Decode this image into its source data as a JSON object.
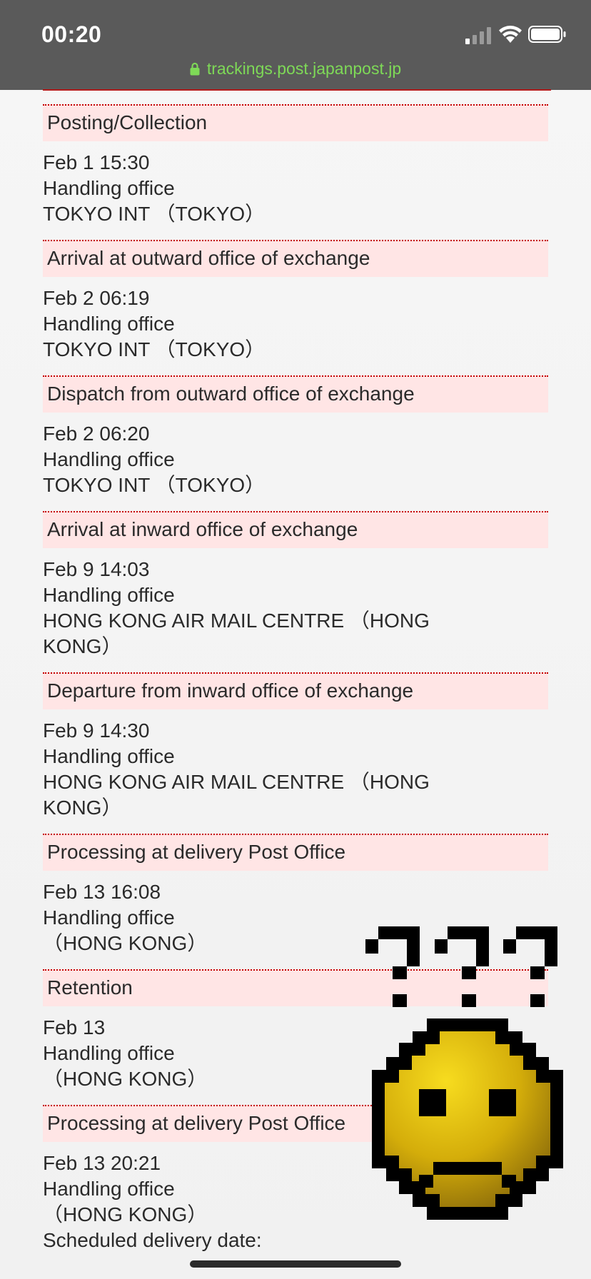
{
  "status_bar": {
    "time": "00:20",
    "url": "trackings.post.japanpost.jp"
  },
  "colors": {
    "status_bg": "#5a5a5a",
    "url_green": "#7ed957",
    "header_bg": "#ffe5e5",
    "rule_red": "#c40000"
  },
  "events": [
    {
      "status": "Posting/Collection",
      "datetime": "Feb 1 15:30",
      "office_label": "Handling office",
      "office": "TOKYO INT （TOKYO）"
    },
    {
      "status": "Arrival at outward office of exchange",
      "datetime": "Feb 2 06:19",
      "office_label": "Handling office",
      "office": "TOKYO INT （TOKYO）"
    },
    {
      "status": "Dispatch from outward office of exchange",
      "datetime": "Feb 2 06:20",
      "office_label": "Handling office",
      "office": "TOKYO INT （TOKYO）"
    },
    {
      "status": "Arrival at inward office of exchange",
      "datetime": "Feb 9 14:03",
      "office_label": "Handling office",
      "office": "HONG KONG AIR MAIL CENTRE （HONG KONG）"
    },
    {
      "status": "Departure from inward office of exchange",
      "datetime": "Feb 9 14:30",
      "office_label": "Handling office",
      "office": "HONG KONG AIR MAIL CENTRE （HONG KONG）"
    },
    {
      "status": "Processing at delivery Post Office",
      "datetime": "Feb 13 16:08",
      "office_label": "Handling office",
      "office": "（HONG KONG）"
    },
    {
      "status": "Retention",
      "datetime": "Feb 13",
      "office_label": "Handling office",
      "office": "（HONG KONG）"
    },
    {
      "status": "Processing at delivery Post Office",
      "datetime": "Feb 13 20:21",
      "office_label": "Handling office",
      "office": "（HONG KONG）",
      "extra": "Scheduled delivery date:"
    }
  ],
  "overlay": {
    "icon": "confused-smiley-icon",
    "marks": "???"
  }
}
